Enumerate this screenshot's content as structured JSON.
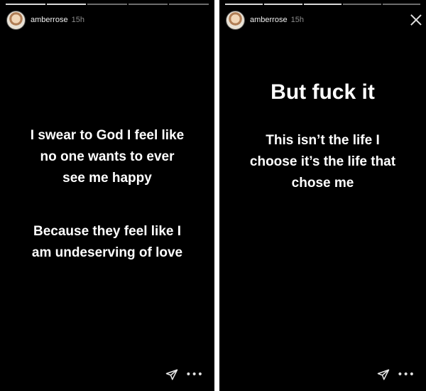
{
  "stories": [
    {
      "username": "amberrose",
      "time": "15h",
      "lines": [
        "I swear to God I feel like\nno one wants to ever\nsee me happy",
        "Because they feel like I\nam undeserving of love"
      ],
      "more": "•••"
    },
    {
      "username": "amberrose",
      "time": "15h",
      "heading": "But fuck it",
      "lines": [
        "This isn’t the life I\nchoose it’s the life that\nchose me"
      ],
      "more": "•••"
    }
  ],
  "icons": {
    "close": "close-icon",
    "send": "send-icon",
    "more": "more-icon"
  },
  "colors": {
    "background": "#000000",
    "text": "#ffffff",
    "time": "#8c8c8c"
  }
}
